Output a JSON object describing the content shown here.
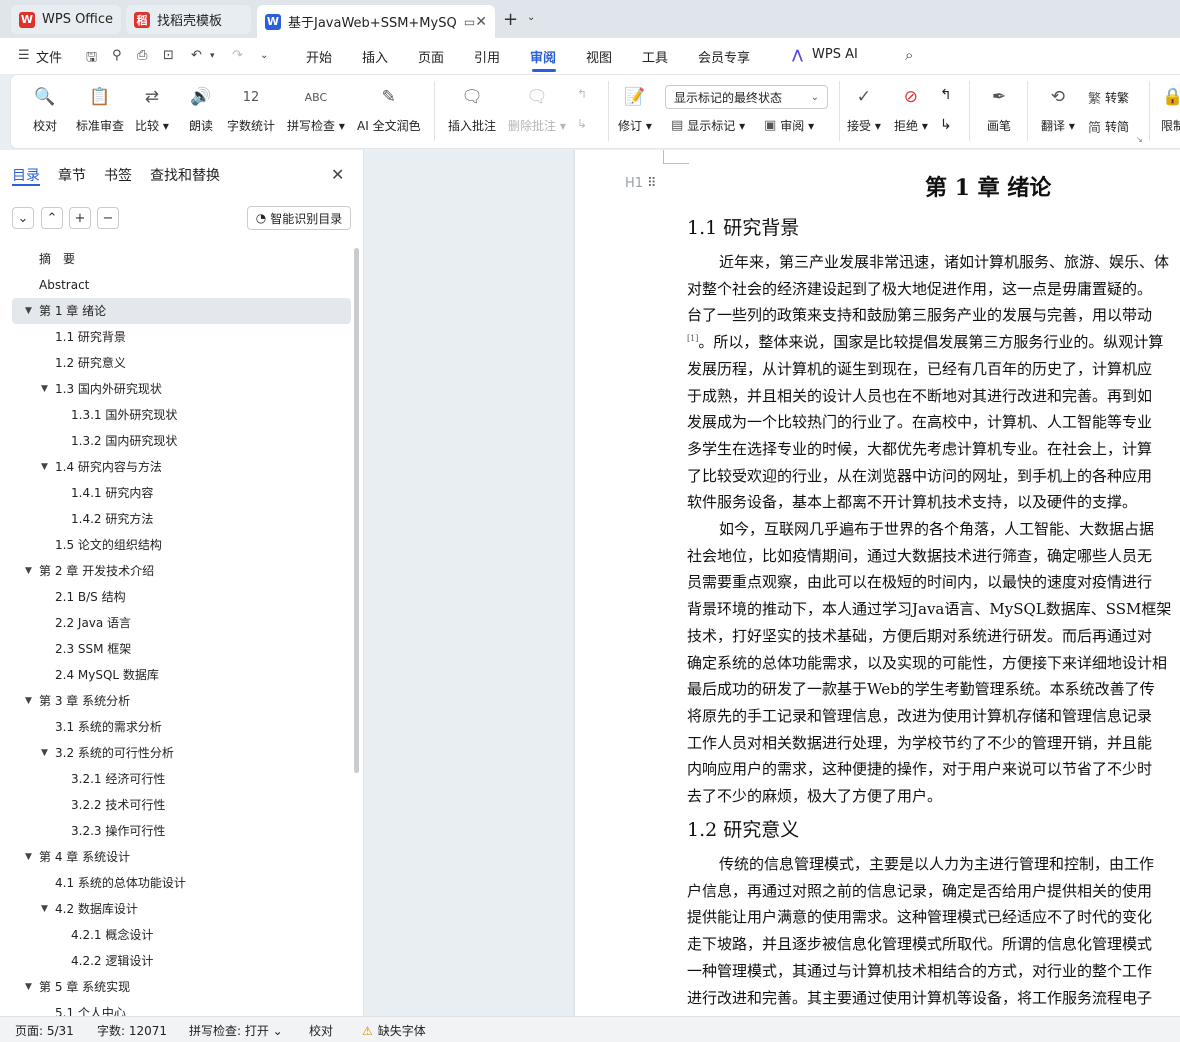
{
  "tabs": [
    {
      "label": "WPS Office",
      "icon": "wps-logo-icon",
      "color": "#e0312b"
    },
    {
      "label": "找稻壳模板",
      "icon": "docer-logo-icon",
      "color": "#e0312b"
    },
    {
      "label": "基于JavaWeb+SSM+MySQL",
      "icon": "writer-doc-icon",
      "color": "#2b5fd9",
      "close": "✕"
    }
  ],
  "menubar": {
    "file": "文件",
    "items": [
      "开始",
      "插入",
      "页面",
      "引用",
      "审阅",
      "视图",
      "工具",
      "会员专享"
    ],
    "active": "审阅",
    "ai": "WPS AI"
  },
  "ribbon": {
    "proofread": "校对",
    "std_review": "标准审查",
    "compare": "比较",
    "read_aloud": "朗读",
    "word_count": "字数统计",
    "spell_check": "拼写检查",
    "ai_polish": "AI 全文润色",
    "insert_comment": "插入批注",
    "delete_comment": "删除批注",
    "track_changes": "修订",
    "markup_combo": "显示标记的最终状态",
    "show_markup": "显示标记",
    "review": "审阅",
    "accept": "接受",
    "reject": "拒绝",
    "pen": "画笔",
    "translate": "翻译",
    "to_traditional": "转繁",
    "to_simplified": "转简",
    "restrict": "限制"
  },
  "nav": {
    "tabs": [
      "目录",
      "章节",
      "书签",
      "查找和替换"
    ],
    "active_tab": "目录",
    "smart_button": "智能识别目录",
    "toc": [
      {
        "label": "摘　要",
        "level": 1,
        "toggle": ""
      },
      {
        "label": "Abstract",
        "level": 1,
        "toggle": ""
      },
      {
        "label": "第 1 章  绪论",
        "level": 1,
        "toggle": "▼",
        "selected": true
      },
      {
        "label": "1.1 研究背景",
        "level": 2,
        "toggle": ""
      },
      {
        "label": "1.2 研究意义",
        "level": 2,
        "toggle": ""
      },
      {
        "label": "1.3 国内外研究现状",
        "level": 2,
        "toggle": "▼"
      },
      {
        "label": "1.3.1 国外研究现状",
        "level": 3,
        "toggle": ""
      },
      {
        "label": "1.3.2 国内研究现状",
        "level": 3,
        "toggle": ""
      },
      {
        "label": "1.4 研究内容与方法",
        "level": 2,
        "toggle": "▼"
      },
      {
        "label": "1.4.1 研究内容",
        "level": 3,
        "toggle": ""
      },
      {
        "label": "1.4.2 研究方法",
        "level": 3,
        "toggle": ""
      },
      {
        "label": "1.5 论文的组织结构",
        "level": 2,
        "toggle": ""
      },
      {
        "label": "第 2 章  开发技术介绍",
        "level": 1,
        "toggle": "▼"
      },
      {
        "label": "2.1 B/S 结构",
        "level": 2,
        "toggle": ""
      },
      {
        "label": "2.2 Java 语言",
        "level": 2,
        "toggle": ""
      },
      {
        "label": "2.3 SSM 框架",
        "level": 2,
        "toggle": ""
      },
      {
        "label": "2.4 MySQL 数据库",
        "level": 2,
        "toggle": ""
      },
      {
        "label": "第 3 章  系统分析",
        "level": 1,
        "toggle": "▼"
      },
      {
        "label": "3.1 系统的需求分析",
        "level": 2,
        "toggle": ""
      },
      {
        "label": "3.2 系统的可行性分析",
        "level": 2,
        "toggle": "▼"
      },
      {
        "label": "3.2.1 经济可行性",
        "level": 3,
        "toggle": ""
      },
      {
        "label": "3.2.2 技术可行性",
        "level": 3,
        "toggle": ""
      },
      {
        "label": "3.2.3 操作可行性",
        "level": 3,
        "toggle": ""
      },
      {
        "label": "第 4 章  系统设计",
        "level": 1,
        "toggle": "▼"
      },
      {
        "label": "4.1 系统的总体功能设计",
        "level": 2,
        "toggle": ""
      },
      {
        "label": "4.2 数据库设计",
        "level": 2,
        "toggle": "▼"
      },
      {
        "label": "4.2.1 概念设计",
        "level": 3,
        "toggle": ""
      },
      {
        "label": "4.2.2 逻辑设计",
        "level": 3,
        "toggle": ""
      },
      {
        "label": "第 5 章  系统实现",
        "level": 1,
        "toggle": "▼"
      },
      {
        "label": "5.1 个人中心",
        "level": 2,
        "toggle": ""
      }
    ]
  },
  "document": {
    "chapter_title": "第 1 章  绪论",
    "h1_marker": "H1",
    "section1_title": "1.1 研究背景",
    "section1_lines": [
      "近年来，第三产业发展非常迅速，诸如计算机服务、旅游、娱乐、体",
      "对整个社会的经济建设起到了极大地促进作用，这一点是毋庸置疑的。",
      "台了一些列的政策来支持和鼓励第三服务产业的发展与完善，用以带动",
      "。所以，整体来说，国家是比较提倡发展第三方服务行业的。纵观计算",
      "发展历程，从计算机的诞生到现在，已经有几百年的历史了，计算机应",
      "于成熟，并且相关的设计人员也在不断地对其进行改进和完善。再到如",
      "发展成为一个比较热门的行业了。在高校中，计算机、人工智能等专业",
      "多学生在选择专业的时候，大都优先考虑计算机专业。在社会上，计算",
      "了比较受欢迎的行业，从在浏览器中访问的网址，到手机上的各种应用",
      "软件服务设备，基本上都离不开计算机技术支持，以及硬件的支撑。",
      "如今，互联网几乎遍布于世界的各个角落，人工智能、大数据占据",
      "社会地位，比如疫情期间，通过大数据技术进行筛查，确定哪些人员无",
      "员需要重点观察，由此可以在极短的时间内，以最快的速度对疫情进行",
      "背景环境的推动下，本人通过学习Java语言、MySQL数据库、SSM框架",
      "技术，打好坚实的技术基础，方便后期对系统进行研发。而后再通过对",
      "确定系统的总体功能需求，以及实现的可能性，方便接下来详细地设计相",
      "最后成功的研发了一款基于Web的学生考勤管理系统。本系统改善了传",
      "将原先的手工记录和管理信息，改进为使用计算机存储和管理信息记录",
      "工作人员对相关数据进行处理，为学校节约了不少的管理开销，并且能",
      "内响应用户的需求，这种便捷的操作，对于用户来说可以节省了不少时",
      "去了不少的麻烦，极大了方便了用户。"
    ],
    "ref_mark": "[1]",
    "section2_title": "1.2 研究意义",
    "section2_lines": [
      "传统的信息管理模式，主要是以人力为主进行管理和控制，由工作",
      "户信息，再通过对照之前的信息记录，确定是否给用户提供相关的使用",
      "提供能让用户满意的使用需求。这种管理模式已经适应不了时代的变化",
      "走下坡路，并且逐步被信息化管理模式所取代。所谓的信息化管理模式",
      "一种管理模式，其通过与计算机技术相结合的方式，对行业的整个工作",
      "进行改进和完善。其主要通过使用计算机等设备，将工作服务流程电子"
    ]
  },
  "status": {
    "page": "页面: 5/31",
    "words": "字数: 12071",
    "spell": "拼写检查: 打开",
    "proof": "校对",
    "missing_font": "缺失字体"
  }
}
